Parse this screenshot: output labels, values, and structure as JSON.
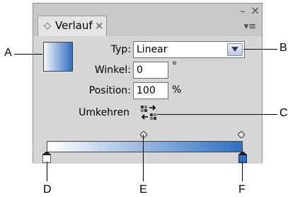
{
  "panel": {
    "tab_label": "Verlauf",
    "tab_icon": "expand-icon",
    "tab_close": "×",
    "minimize": "–",
    "close": "×",
    "menu": "▾≡"
  },
  "form": {
    "type_label": "Typ:",
    "type_value": "Linear",
    "angle_label": "Winkel:",
    "angle_value": "0",
    "angle_unit": "°",
    "position_label": "Position:",
    "position_value": "100",
    "position_unit": "%",
    "reverse_label": "Umkehren"
  },
  "gradient": {
    "start_color": "#ffffff",
    "end_color": "#2d6fc2"
  },
  "callouts": {
    "a": "A",
    "b": "B",
    "c": "C",
    "d": "D",
    "e": "E",
    "f": "F"
  }
}
